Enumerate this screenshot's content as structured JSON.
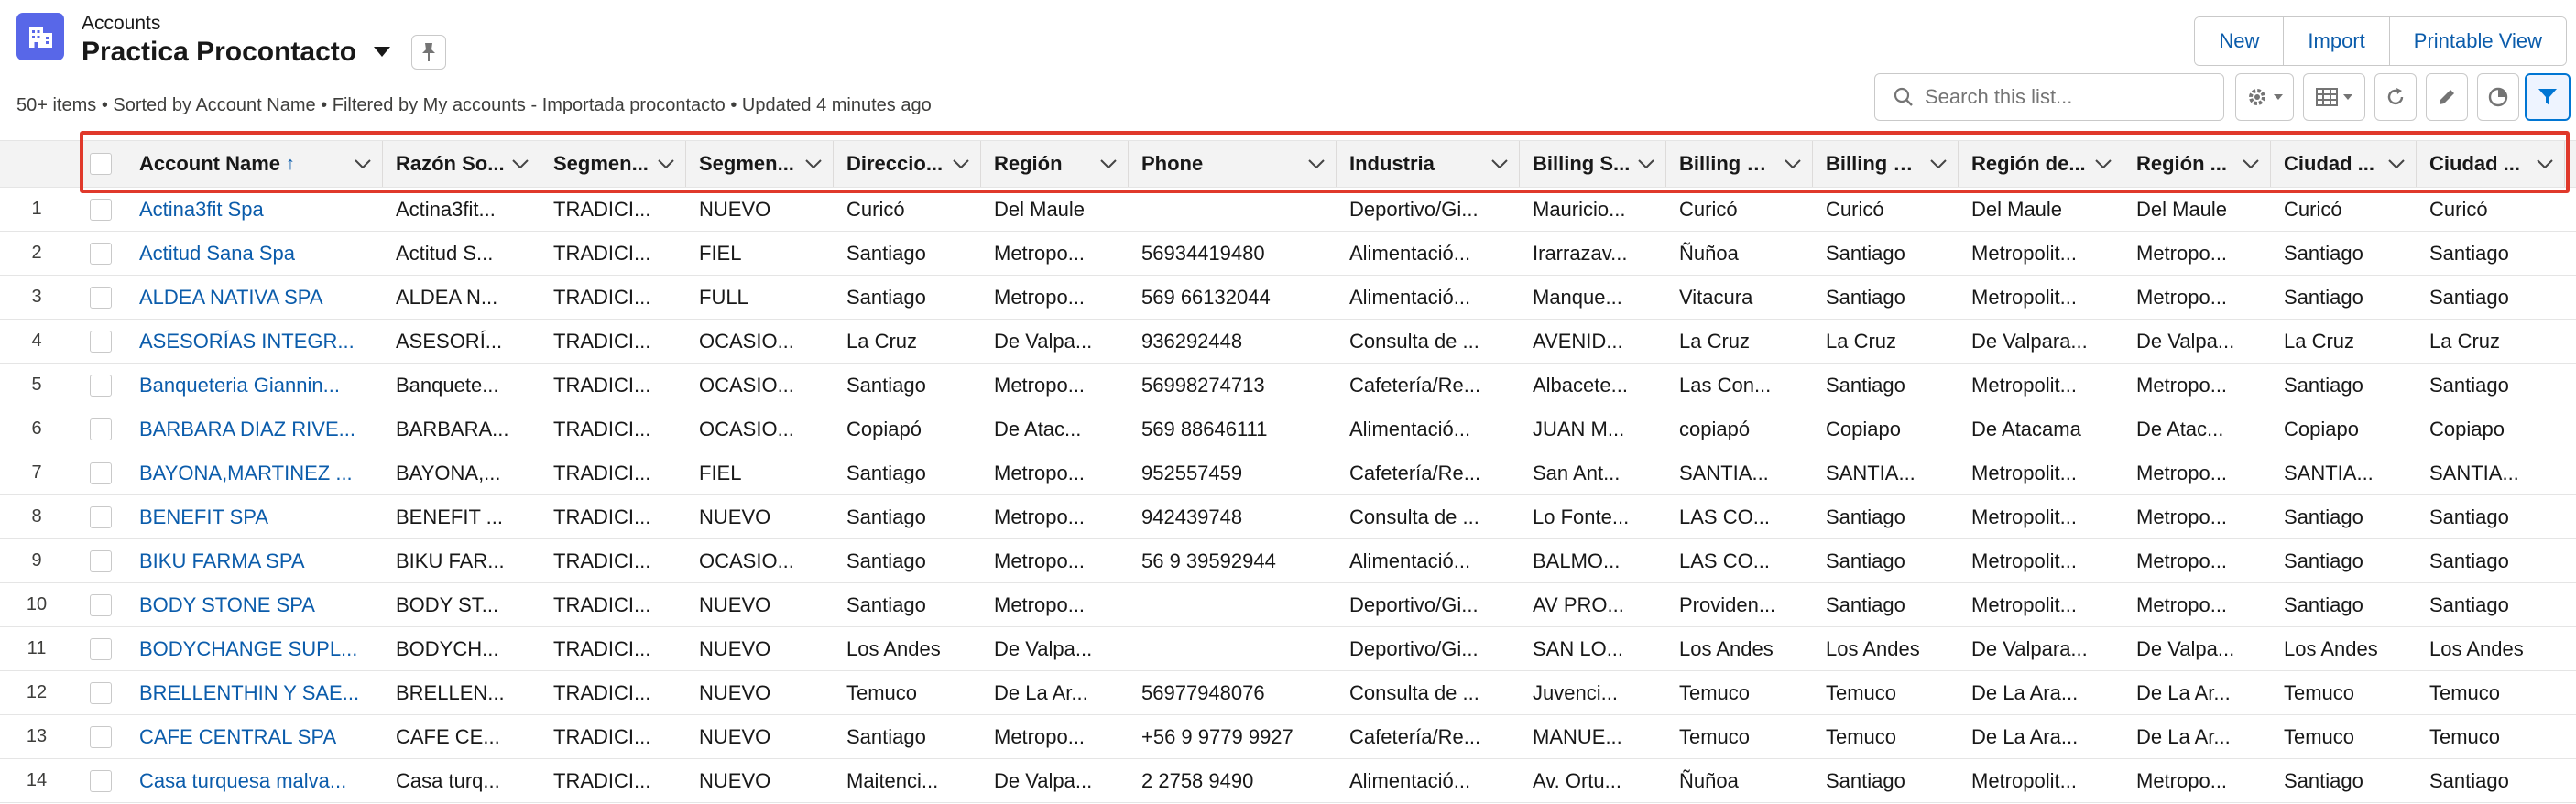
{
  "header": {
    "object_label": "Accounts",
    "list_view_name": "Practica Procontacto",
    "summary": "50+ items • Sorted by Account Name • Filtered by My accounts - Importada procontacto • Updated 4 minutes ago"
  },
  "actions": {
    "new_label": "New",
    "import_label": "Import",
    "printable_label": "Printable View"
  },
  "search": {
    "placeholder": "Search this list...",
    "value": ""
  },
  "toolbar_icons": [
    "gear-icon",
    "table-icon",
    "refresh-icon",
    "pencil-icon",
    "pie-chart-icon",
    "filter-icon"
  ],
  "table": {
    "sort_column": "Account Name",
    "sort_direction": "ascending",
    "columns": [
      "Account Name",
      "Razón So...",
      "Segmen...",
      "Segmen...",
      "Direccio...",
      "Región",
      "Phone",
      "Industria",
      "Billing S...",
      "Billing C...",
      "Billing S...",
      "Región de...",
      "Región ...",
      "Ciudad ...",
      "Ciudad ..."
    ],
    "rows": [
      {
        "num": "1",
        "cells": [
          "Actina3fit Spa",
          "Actina3fit...",
          "TRADICI...",
          "NUEVO",
          "Curicó",
          "Del Maule",
          "",
          "Deportivo/Gi...",
          "Mauricio...",
          "Curicó",
          "Curicó",
          "Del Maule",
          "Del Maule",
          "Curicó",
          "Curicó"
        ]
      },
      {
        "num": "2",
        "cells": [
          "Actitud Sana Spa",
          "Actitud S...",
          "TRADICI...",
          "FIEL",
          "Santiago",
          "Metropo...",
          "56934419480",
          "Alimentació...",
          "Irarrazav...",
          "Ñuñoa",
          "Santiago",
          "Metropolit...",
          "Metropo...",
          "Santiago",
          "Santiago"
        ]
      },
      {
        "num": "3",
        "cells": [
          "ALDEA NATIVA SPA",
          "ALDEA N...",
          "TRADICI...",
          "FULL",
          "Santiago",
          "Metropo...",
          "569 66132044",
          "Alimentació...",
          "Manque...",
          "Vitacura",
          "Santiago",
          "Metropolit...",
          "Metropo...",
          "Santiago",
          "Santiago"
        ]
      },
      {
        "num": "4",
        "cells": [
          "ASESORÍAS INTEGR...",
          "ASESORÍ...",
          "TRADICI...",
          "OCASIO...",
          "La Cruz",
          "De Valpa...",
          "936292448",
          "Consulta de ...",
          "AVENID...",
          "La Cruz",
          "La Cruz",
          "De Valpara...",
          "De Valpa...",
          "La Cruz",
          "La Cruz"
        ]
      },
      {
        "num": "5",
        "cells": [
          "Banqueteria Giannin...",
          "Banquete...",
          "TRADICI...",
          "OCASIO...",
          "Santiago",
          "Metropo...",
          "56998274713",
          "Cafetería/Re...",
          "Albacete...",
          "Las Con...",
          "Santiago",
          "Metropolit...",
          "Metropo...",
          "Santiago",
          "Santiago"
        ]
      },
      {
        "num": "6",
        "cells": [
          "BARBARA DIAZ RIVE...",
          "BARBARA...",
          "TRADICI...",
          "OCASIO...",
          "Copiapó",
          "De Atac...",
          "569 88646111",
          "Alimentació...",
          "JUAN M...",
          "copiapó",
          "Copiapo",
          "De Atacama",
          "De Atac...",
          "Copiapo",
          "Copiapo"
        ]
      },
      {
        "num": "7",
        "cells": [
          "BAYONA,MARTINEZ ...",
          "BAYONA,...",
          "TRADICI...",
          "FIEL",
          "Santiago",
          "Metropo...",
          "952557459",
          "Cafetería/Re...",
          "San Ant...",
          "SANTIA...",
          "SANTIA...",
          "Metropolit...",
          "Metropo...",
          "SANTIA...",
          "SANTIA..."
        ]
      },
      {
        "num": "8",
        "cells": [
          "BENEFIT SPA",
          "BENEFIT ...",
          "TRADICI...",
          "NUEVO",
          "Santiago",
          "Metropo...",
          "942439748",
          "Consulta de ...",
          "Lo Fonte...",
          "LAS CO...",
          "Santiago",
          "Metropolit...",
          "Metropo...",
          "Santiago",
          "Santiago"
        ]
      },
      {
        "num": "9",
        "cells": [
          "BIKU FARMA SPA",
          "BIKU FAR...",
          "TRADICI...",
          "OCASIO...",
          "Santiago",
          "Metropo...",
          "56 9 39592944",
          "Alimentació...",
          "BALMO...",
          "LAS CO...",
          "Santiago",
          "Metropolit...",
          "Metropo...",
          "Santiago",
          "Santiago"
        ]
      },
      {
        "num": "10",
        "cells": [
          "BODY STONE SPA",
          "BODY ST...",
          "TRADICI...",
          "NUEVO",
          "Santiago",
          "Metropo...",
          "",
          "Deportivo/Gi...",
          "AV PRO...",
          "Providen...",
          "Santiago",
          "Metropolit...",
          "Metropo...",
          "Santiago",
          "Santiago"
        ]
      },
      {
        "num": "11",
        "cells": [
          "BODYCHANGE SUPL...",
          "BODYCH...",
          "TRADICI...",
          "NUEVO",
          "Los Andes",
          "De Valpa...",
          "",
          "Deportivo/Gi...",
          "SAN LO...",
          "Los Andes",
          "Los Andes",
          "De Valpara...",
          "De Valpa...",
          "Los Andes",
          "Los Andes"
        ]
      },
      {
        "num": "12",
        "cells": [
          "BRELLENTHIN Y SAE...",
          "BRELLEN...",
          "TRADICI...",
          "NUEVO",
          "Temuco",
          "De La Ar...",
          "56977948076",
          "Consulta de ...",
          "Juvenci...",
          "Temuco",
          "Temuco",
          "De La Ara...",
          "De La Ar...",
          "Temuco",
          "Temuco"
        ]
      },
      {
        "num": "13",
        "cells": [
          "CAFE CENTRAL SPA",
          "CAFE CE...",
          "TRADICI...",
          "NUEVO",
          "Santiago",
          "Metropo...",
          "+56 9 9779 9927",
          "Cafetería/Re...",
          "MANUE...",
          "Temuco",
          "Temuco",
          "De La Ara...",
          "De La Ar...",
          "Temuco",
          "Temuco"
        ]
      },
      {
        "num": "14",
        "cells": [
          "Casa turquesa malva...",
          "Casa turq...",
          "TRADICI...",
          "NUEVO",
          "Maitenci...",
          "De Valpa...",
          "2 2758 9490",
          "Alimentació...",
          "Av. Ortu...",
          "Ñuñoa",
          "Santiago",
          "Metropolit...",
          "Metropo...",
          "Santiago",
          "Santiago"
        ]
      }
    ]
  },
  "colors": {
    "link": "#0b5cab",
    "app_icon_bg": "#5867e8",
    "highlight_border": "#e0392b",
    "header_bg": "#f3f3f3"
  }
}
